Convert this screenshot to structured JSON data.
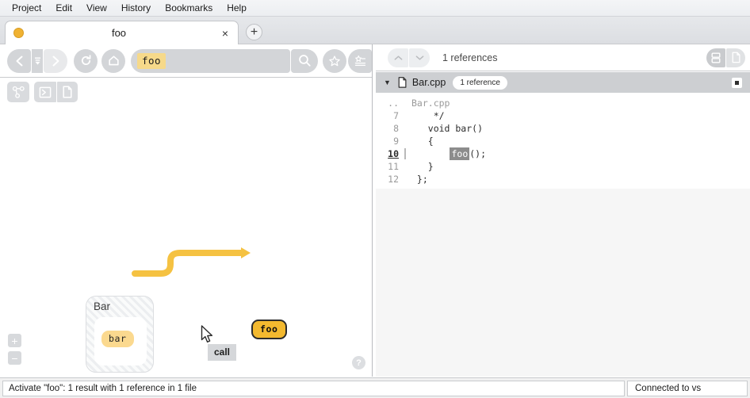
{
  "menubar": {
    "items": [
      {
        "label": "Project"
      },
      {
        "label": "Edit"
      },
      {
        "label": "View"
      },
      {
        "label": "History"
      },
      {
        "label": "Bookmarks"
      },
      {
        "label": "Help"
      }
    ]
  },
  "tabbar": {
    "tab_title": "foo",
    "close_label": "×",
    "new_tab_label": "+"
  },
  "searchbar": {
    "query_token": "foo",
    "icons": {
      "back": "back-arrow-icon",
      "history": "history-dropdown-icon",
      "forward": "forward-arrow-icon",
      "refresh": "refresh-icon",
      "home": "home-icon",
      "search": "search-icon",
      "bookmark": "star-icon",
      "bookmark_list": "bookmark-list-icon"
    }
  },
  "graph_toolbar": {
    "buttons": [
      {
        "name": "graph-view-icon"
      },
      {
        "name": "console-icon"
      },
      {
        "name": "file-icon"
      }
    ]
  },
  "graph": {
    "class_node": {
      "label": "Bar"
    },
    "member_node": {
      "label": "bar"
    },
    "target_node": {
      "label": "foo"
    },
    "edge_label": "call",
    "zoom_in": "+",
    "zoom_out": "−",
    "help": "?",
    "colors": {
      "edge": "#f5c242",
      "target_fill": "#f3b92f",
      "member_fill": "#fbd98f",
      "label_bg": "#d5d7da"
    }
  },
  "code_panel": {
    "reference_count_label": "1 references",
    "nav_up": "∧",
    "nav_down": "∨",
    "view_modes": [
      {
        "name": "snippet-view-icon",
        "active": true
      },
      {
        "name": "file-view-icon",
        "active": false
      }
    ],
    "file": {
      "name": "Bar.cpp",
      "badge": "1 reference",
      "caret": "▼"
    },
    "ellipsis_row": {
      "marker": "..",
      "text": "Bar.cpp"
    },
    "lines": [
      {
        "number": "7",
        "pre": "    */",
        "token": "",
        "post": "",
        "current": false
      },
      {
        "number": "8",
        "pre": "   void bar()",
        "token": "",
        "post": "",
        "current": false
      },
      {
        "number": "9",
        "pre": "   {",
        "token": "",
        "post": "",
        "current": false
      },
      {
        "number": "10",
        "pre": "       ",
        "token": "foo",
        "post": "();",
        "current": true
      },
      {
        "number": "11",
        "pre": "   }",
        "token": "",
        "post": "",
        "current": false
      },
      {
        "number": "12",
        "pre": " };",
        "token": "",
        "post": "",
        "current": false
      }
    ]
  },
  "statusbar": {
    "message": "Activate \"foo\": 1 result with 1 reference in 1 file",
    "connection": "Connected to vs"
  }
}
